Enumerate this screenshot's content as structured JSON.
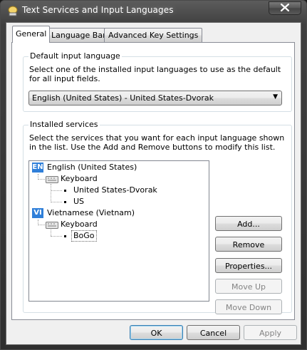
{
  "window": {
    "title": "Text Services and Input Languages"
  },
  "tabs": [
    {
      "label": "General"
    },
    {
      "label": "Language Bar"
    },
    {
      "label": "Advanced Key Settings"
    }
  ],
  "default_input_language": {
    "group_label": "Default input language",
    "description": "Select one of the installed input languages to use as the default for all input fields.",
    "selected_value": "English (United States) - United States-Dvorak"
  },
  "installed_services": {
    "group_label": "Installed services",
    "description": "Select the services that you want for each input language shown in the list. Use the Add and Remove buttons to modify this list.",
    "languages": [
      {
        "badge": "EN",
        "name": "English (United States)",
        "category": "Keyboard",
        "services": [
          "United States-Dvorak",
          "US"
        ]
      },
      {
        "badge": "VI",
        "name": "Vietnamese (Vietnam)",
        "category": "Keyboard",
        "services": [
          "BoGo"
        ]
      }
    ],
    "selected_service": "BoGo",
    "buttons": {
      "add": "Add...",
      "remove": "Remove",
      "properties": "Properties...",
      "move_up": "Move Up",
      "move_down": "Move Down"
    }
  },
  "footer": {
    "ok": "OK",
    "cancel": "Cancel",
    "apply": "Apply"
  },
  "colors": {
    "language_badge": "#2f7fd9",
    "titlebar": "#3f3f3f"
  }
}
